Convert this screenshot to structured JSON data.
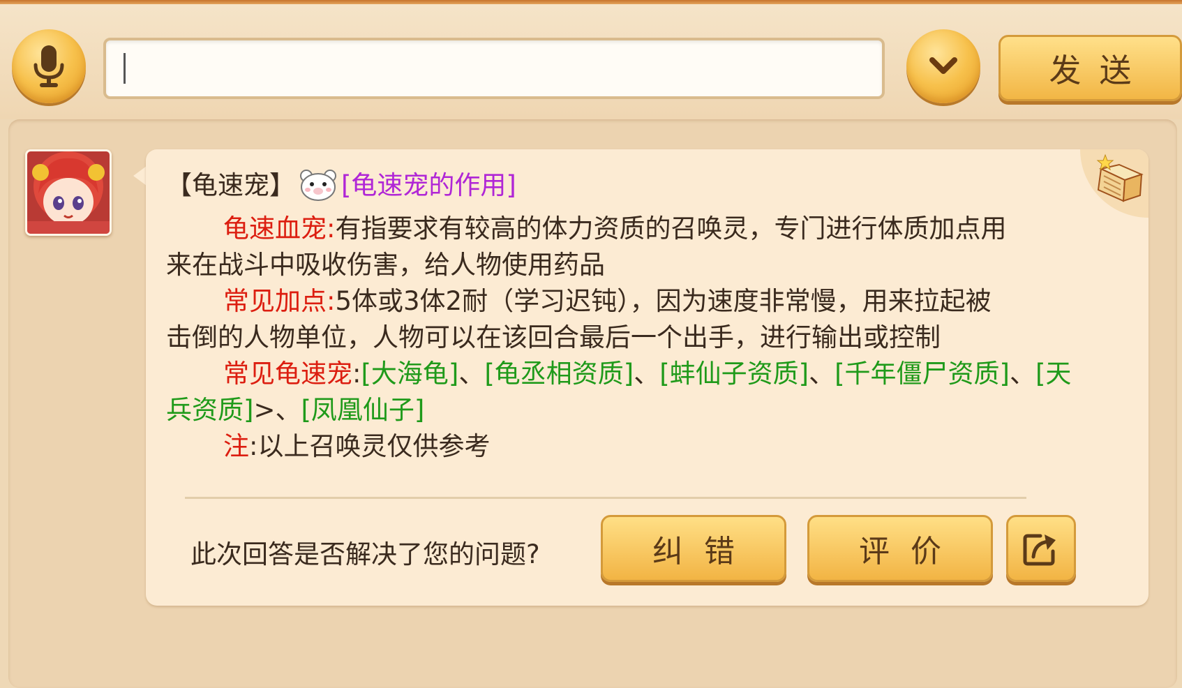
{
  "input_bar": {
    "mic_icon": "microphone-icon",
    "expand_icon": "chevron-down-icon",
    "placeholder": "",
    "value": "",
    "send_label": "发送"
  },
  "message": {
    "tag": "【龟速宠】",
    "title_link": "[龟速宠的作用]",
    "para1_label": "龟速血宠:",
    "para1_text_a": "有指要求有较高的体力资质的召唤灵，专门进行体质加点用",
    "para1_text_b": "来在战斗中吸收伤害，给人物使用药品",
    "para2_label": "常见加点:",
    "para2_text_a": "5体或3体2耐（学习迟钝），因为速度非常慢，用来拉起被",
    "para2_text_b": "击倒的人物单位，人物可以在该回合最后一个出手，进行输出或控制",
    "para3_label": "常见龟速宠",
    "para3_colon": ":",
    "pets": [
      "[大海龟]",
      "[龟丞相资质]",
      "[蚌仙子资质]",
      "[千年僵尸资质]",
      "[天兵资质]",
      "[凤凰仙子]"
    ],
    "sep": "、",
    "stray_bracket": ">",
    "note_label": "注",
    "note_text": ":以上召唤灵仅供参考"
  },
  "feedback": {
    "question": "此次回答是否解决了您的问题?",
    "report_label": "纠错",
    "rate_label": "评价",
    "share_icon": "share-icon"
  },
  "colors": {
    "highlight_red": "#dc1e10",
    "pet_green": "#1f9a1a",
    "link_purple": "#b026d6",
    "button_gold": "#f2b444"
  }
}
